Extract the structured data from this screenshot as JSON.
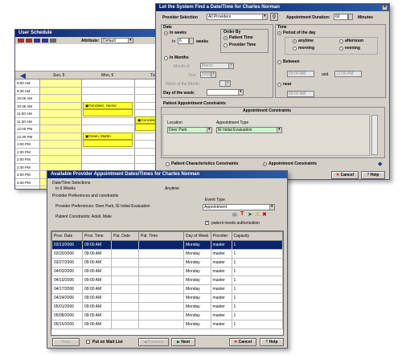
{
  "schedule": {
    "title": "User Schedule",
    "attribute_label": "Attribute:",
    "attribute_value": "Default",
    "day_headers": [
      "Sun, 5",
      "Mon, 6",
      "Tu"
    ],
    "times": [
      "9:00 AM",
      "9:30 AM",
      "10:00 AM",
      "10:30 AM",
      "11:00 AM",
      "11:30 AM",
      "12:00 PM",
      "12:30 PM",
      "1:00 PM",
      "1:30 PM",
      "2:00 PM",
      "2:30 PM",
      "3:00 PM",
      "3:30 PM",
      "4:00 PM",
      "4:30 PM",
      "5:00 PM",
      "5:30 PM",
      "6:00 PM",
      "6:30 PM"
    ],
    "appt1": "Gonzalez, Hector",
    "appt2": "Gonzalez",
    "appt3": "Green, Martin"
  },
  "finder": {
    "title": "Let the System Find a Date/Time for Charles  Norman",
    "provider_label": "Provider Selection",
    "provider_value": "All Providers",
    "duration_label": "Appointment Duration:",
    "duration_value": "60",
    "minutes_label": "Minutes",
    "date_label": "Date",
    "in_weeks": "In weeks",
    "in_label": "In",
    "weeks_value": "6",
    "weeks_label": "weeks",
    "order_label": "Order By",
    "patient_time": "Patient Time",
    "provider_time": "Provider Time",
    "in_months": "In Months",
    "month_label": "Month of",
    "month_value": "March",
    "year_label": "Year",
    "year_value": "2006",
    "week_month_label": "Week of the Month",
    "dow_label": "Day of the week:",
    "time_label": "Time",
    "period_label": "Period of the day",
    "anytime": "anytime",
    "afternoon": "afternoon",
    "morning": "morning",
    "evening": "evening",
    "between_label": "Between",
    "and_label": "and",
    "t1": "09:00 AM",
    "t2": "12:00 PM",
    "near_label": "near",
    "t3": "09:00 AM",
    "pac_outer": "Patient Appointment Constraints",
    "pac_inner": "Appointment Constraints",
    "location_label": "Location",
    "location_value": "Deer Park",
    "appt_type_label": "Appointment Type",
    "appt_type_value": "IE Initial Evaluation",
    "pcc": "Patient Characteristics Constraints",
    "ac": "Appointment Constraints",
    "cancel": "Cancel",
    "help": "Help"
  },
  "avail": {
    "title": "Available Provider Appointment Dates/Times for Charles  Norman",
    "selections_label": "Date/Time Selections",
    "in6": "In 6 Weeks",
    "anytime": "Anytime",
    "pref_label": "Provider Preferences and constraints",
    "pref_text": "Provider Preferences: Deer Park, IE Initial Evaluation",
    "pc_text": "Patient Constraints: Adult, Male",
    "event_type_label": "Event Type",
    "event_type_value": "Appointment",
    "auth_label": "patient needs authorization",
    "columns": [
      "Prov. Date",
      "Prov. Time",
      "Pat. Date",
      "Pat. Time",
      "Day of Week",
      "Provider",
      "Capacity"
    ],
    "rows": [
      [
        "03/13/2006",
        "09:00 AM",
        "",
        "",
        "Monday",
        "master",
        "1"
      ],
      [
        "03/20/2006",
        "09:00 AM",
        "",
        "",
        "Monday",
        "master",
        "1"
      ],
      [
        "03/27/2006",
        "09:00 AM",
        "",
        "",
        "Monday",
        "master",
        "1"
      ],
      [
        "04/03/2006",
        "09:00 AM",
        "",
        "",
        "Monday",
        "master",
        "1"
      ],
      [
        "04/10/2006",
        "09:00 AM",
        "",
        "",
        "Monday",
        "master",
        "1"
      ],
      [
        "04/17/2006",
        "09:00 AM",
        "",
        "",
        "Monday",
        "master",
        "1"
      ],
      [
        "04/24/2006",
        "09:00 AM",
        "",
        "",
        "Monday",
        "master",
        "1"
      ],
      [
        "05/01/2006",
        "09:00 AM",
        "",
        "",
        "Monday",
        "master",
        "1"
      ],
      [
        "05/08/2006",
        "09:00 AM",
        "",
        "",
        "Monday",
        "master",
        "1"
      ],
      [
        "05/15/2006",
        "09:00 AM",
        "",
        "",
        "Monday",
        "master",
        "1"
      ]
    ],
    "post": "Post",
    "waitlist": "Put on Wait List",
    "previous": "Previous",
    "next": "Next",
    "cancel": "Cancel",
    "help": "Help"
  }
}
